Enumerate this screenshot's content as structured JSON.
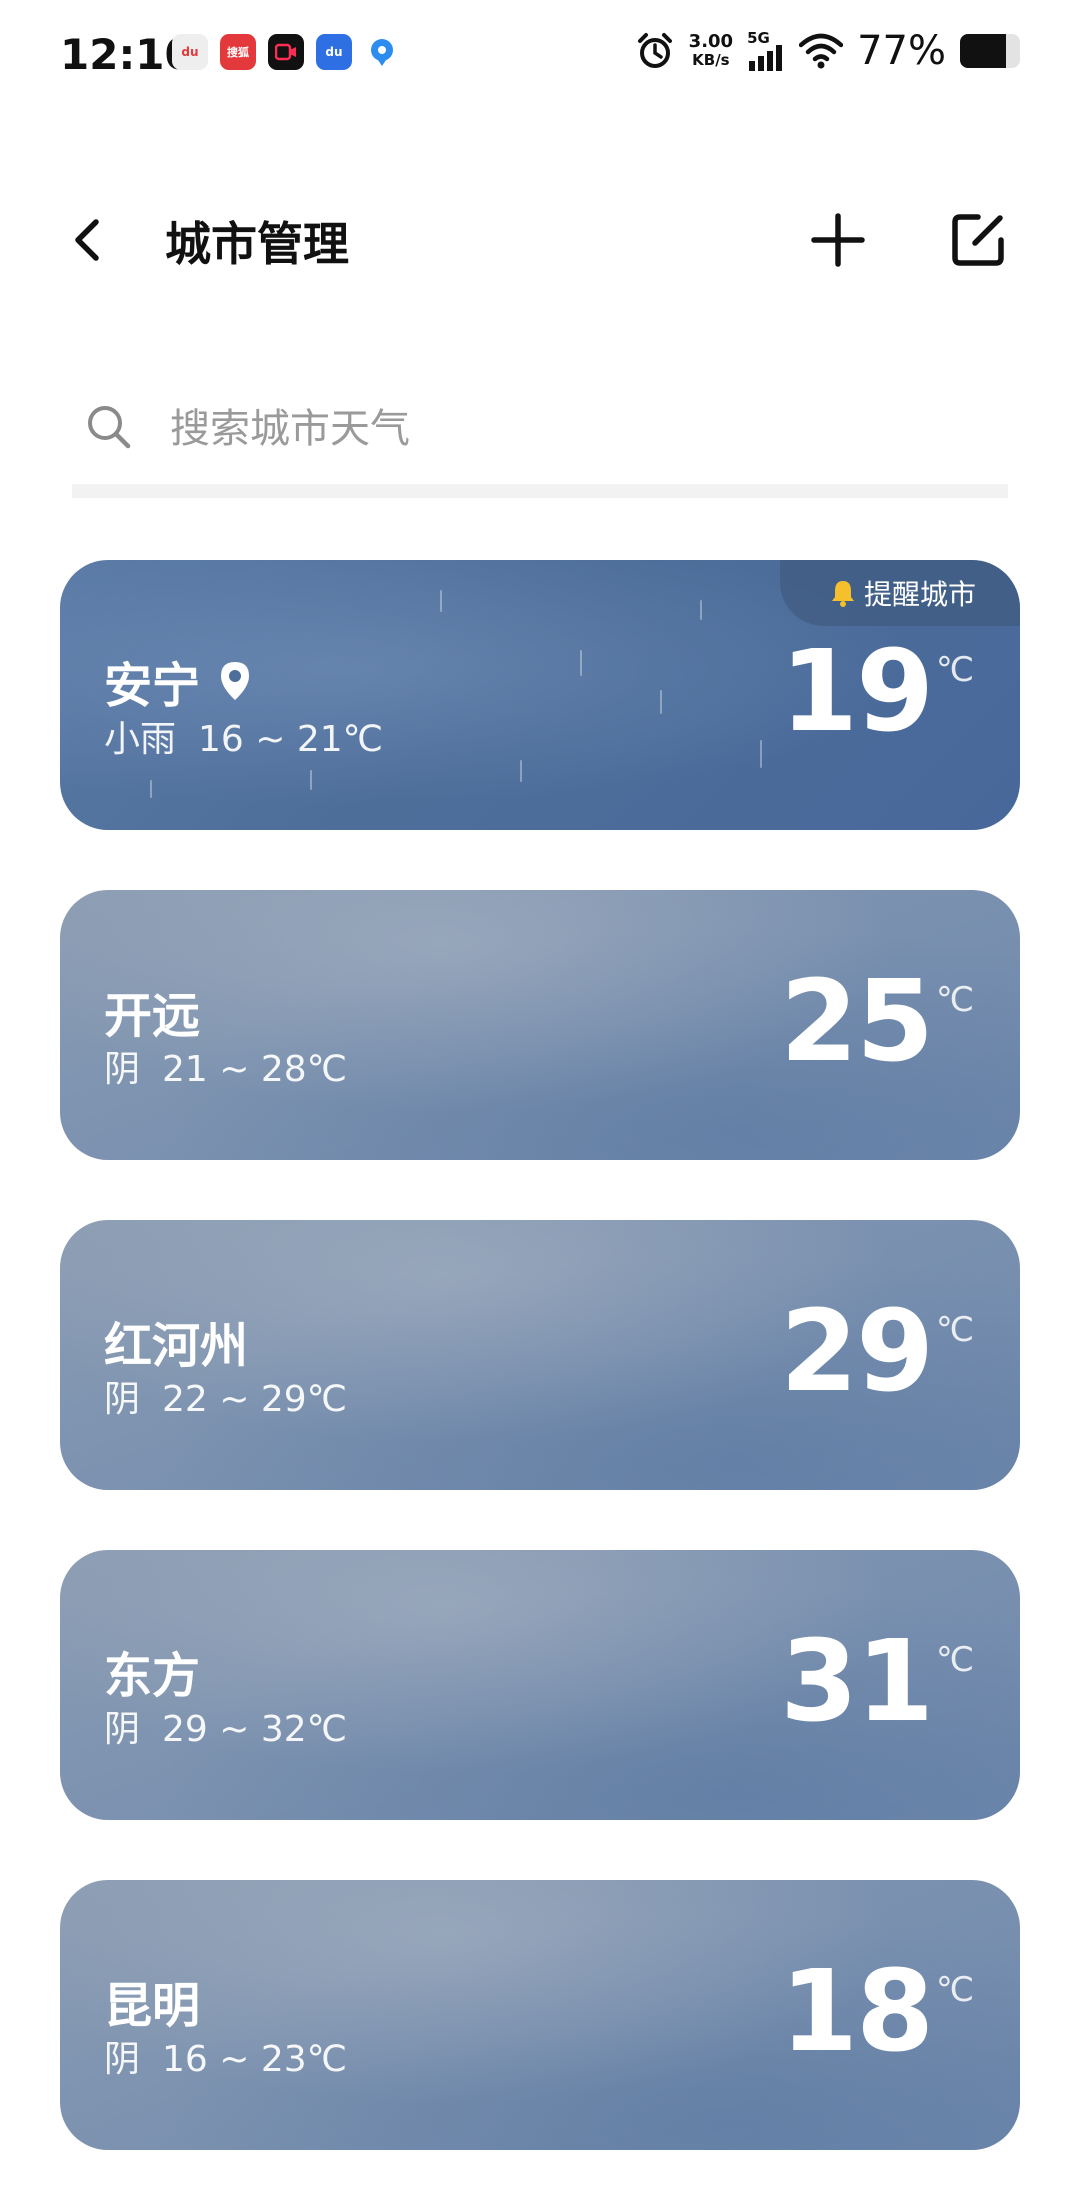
{
  "status_bar": {
    "time": "12:10",
    "apps": [
      {
        "icon": "baidu-map-icon",
        "text": "du",
        "color": "#e8e8e8"
      },
      {
        "icon": "sohu-video-icon",
        "text": "搜狐",
        "color": "#e4393c"
      },
      {
        "icon": "video-camera-app-icon",
        "text": "",
        "color": "#111111"
      },
      {
        "icon": "baidu-app-icon",
        "text": "du",
        "color": "#2f6fe4"
      },
      {
        "icon": "location-app-icon",
        "text": "",
        "color": "#2d8cf0"
      }
    ],
    "net_speed_value": "3.00",
    "net_speed_unit": "KB/s",
    "network": "5G",
    "battery": "77%",
    "battery_level": 0.77
  },
  "header": {
    "title": "城市管理"
  },
  "search": {
    "placeholder": "搜索城市天气"
  },
  "cities": [
    {
      "name": "安宁",
      "located": true,
      "reminder": "提醒城市",
      "condition": "小雨",
      "range": "16 ~ 21℃",
      "temp": "19",
      "unit": "℃",
      "style": "rain"
    },
    {
      "name": "开远",
      "located": false,
      "condition": "阴",
      "range": "21 ~ 28℃",
      "temp": "25",
      "unit": "℃",
      "style": "cloud"
    },
    {
      "name": "红河州",
      "located": false,
      "condition": "阴",
      "range": "22 ~ 29℃",
      "temp": "29",
      "unit": "℃",
      "style": "cloud"
    },
    {
      "name": "东方",
      "located": false,
      "condition": "阴",
      "range": "29 ~ 32℃",
      "temp": "31",
      "unit": "℃",
      "style": "cloud"
    },
    {
      "name": "昆明",
      "located": false,
      "condition": "阴",
      "range": "16 ~ 23℃",
      "temp": "18",
      "unit": "℃",
      "style": "cloud"
    }
  ],
  "colors": {
    "rain_card": "#4e6e9a",
    "cloud_card": "#7d93b0"
  }
}
